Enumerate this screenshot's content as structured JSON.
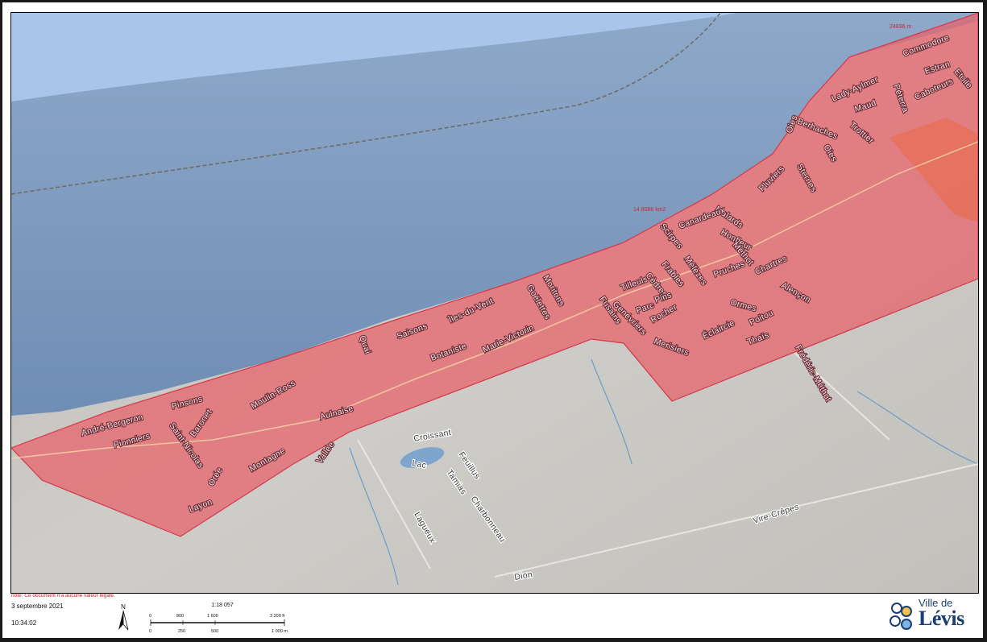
{
  "map": {
    "area_label": "14.8086 km2",
    "corner_label": "24836 m",
    "street_labels": [
      "Commodore",
      "Estran",
      "Etoile",
      "Lady-Aylmer",
      "Péterra",
      "Caboteurs",
      "Maud",
      "Berhaches",
      "Trottier",
      "Oies",
      "Pluviers",
      "Sternes",
      "Malards",
      "Canardeaux",
      "Scirpes",
      "Honfleur",
      "Méthot",
      "Mélèzes",
      "Chartres",
      "Frables",
      "Tilleuls",
      "Moritons",
      "Goëlettes",
      "Cèdres",
      "Pins",
      "Pruches",
      "Alençon",
      "Parc",
      "Genévriers",
      "Fusains",
      "Rocher",
      "Ormes",
      "Poitou",
      "Merisiers",
      "Éclaircie",
      "Thaïs",
      "Îles-du-Vent",
      "Saisons",
      "Botaniste",
      "Marie-Victorin",
      "Quai",
      "Moulin-Ross",
      "Pinsons",
      "André-Bergeron",
      "Baronet",
      "Pionniers",
      "Saint-Nicolas",
      "Aulnaise",
      "Vallée",
      "Montagne",
      "Orée",
      "Layon"
    ],
    "outside_labels": [
      "Frédéric-Méthot",
      "Croissant",
      "Feuillus",
      "Lac",
      "Tamias",
      "Charbonneau",
      "Lagueux",
      "Vire-Crêpes",
      "Dion"
    ]
  },
  "footer": {
    "note": "note: Ce document n'a aucune valeur légale.",
    "date": "3 septembre 2021",
    "time": "10:34:02",
    "north": "N",
    "scale": "1:18 057",
    "ft_ticks": [
      "0",
      "800",
      "1 600",
      "3 200 ft"
    ],
    "m_ticks": [
      "0",
      "250",
      "500",
      "1 000 m"
    ]
  },
  "logo": {
    "ville": "Ville de",
    "name": "Lévis"
  },
  "colors": {
    "water": "#7e9bbf",
    "selection": "#e86068",
    "land": "#c8c6c2",
    "orange": "#e39a3a",
    "brand": "#1b3f74",
    "note": "#e0141f"
  }
}
